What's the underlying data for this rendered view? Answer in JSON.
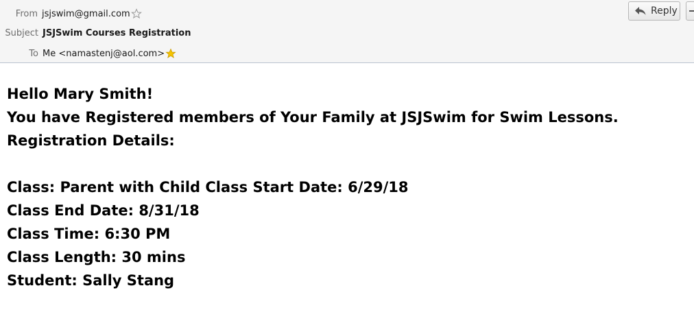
{
  "header": {
    "from_label": "From",
    "from_value": "jsjswim@gmail.com",
    "subject_label": "Subject",
    "subject_value": "JSJSwim Courses Registration",
    "to_label": "To",
    "to_value": "Me <namastenj@aol.com>",
    "reply_label": "Reply",
    "icons": {
      "from_star": "star-outline-icon",
      "to_star": "star-filled-icon",
      "reply": "reply-arrow-icon",
      "more": "dropdown-icon"
    },
    "colors": {
      "star_filled": "#f5c400",
      "header_bg": "#f5f5f5"
    }
  },
  "message": {
    "greeting": "Hello Mary Smith!",
    "intro": "You have Registered members of Your Family at JSJSwim for Swim Lessons.",
    "details_heading": "Registration Details:",
    "class_line": "Class: Parent with Child Class Start Date: 6/29/18",
    "end_date_line": "Class End Date: 8/31/18",
    "time_line": "Class Time: 6:30 PM",
    "length_line": "Class Length: 30 mins",
    "student_line": "Student: Sally Stang"
  }
}
